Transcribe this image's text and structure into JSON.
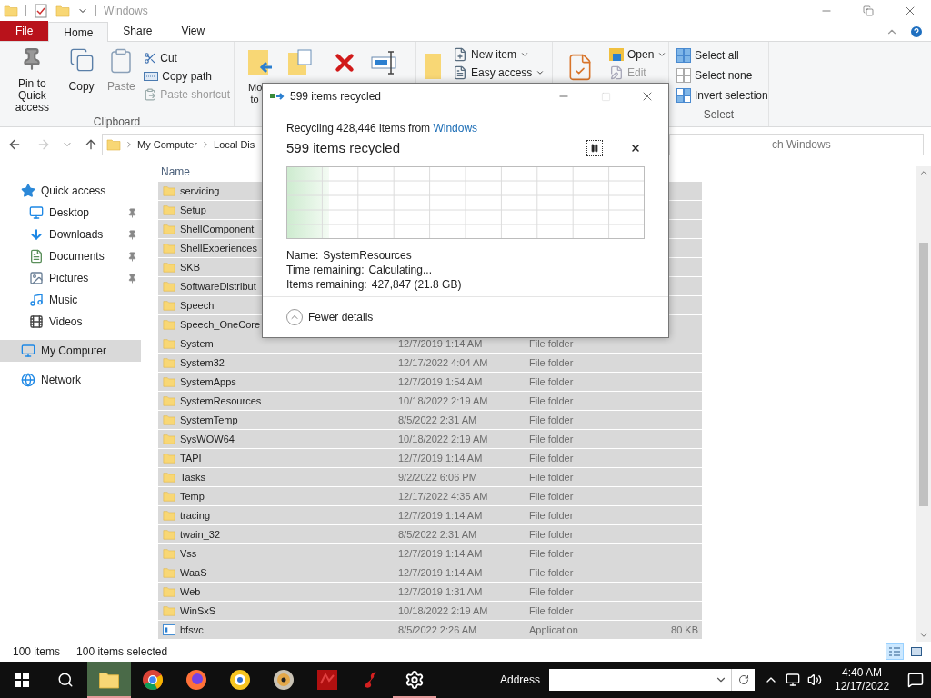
{
  "window": {
    "title": "Windows"
  },
  "ribbon_tabs": [
    {
      "label": "File",
      "kind": "file",
      "selected": false
    },
    {
      "label": "Home",
      "kind": "tab",
      "selected": true
    },
    {
      "label": "Share",
      "kind": "tab",
      "selected": false
    },
    {
      "label": "View",
      "kind": "tab",
      "selected": false
    }
  ],
  "ribbon": {
    "clipboard": {
      "label": "Clipboard",
      "pin": "Pin to Quick access",
      "copy": "Copy",
      "paste": {
        "label": "Paste",
        "disabled": true
      },
      "cut": {
        "label": "Cut",
        "disabled": false
      },
      "copy_path": {
        "label": "Copy path",
        "disabled": false
      },
      "paste_shortcut": {
        "label": "Paste shortcut",
        "disabled": true
      }
    },
    "organize": {
      "move_to": "Mo to"
    },
    "new": {
      "new_item": "New item",
      "easy_access": "Easy access"
    },
    "open": {
      "open": {
        "label": "Open",
        "disabled": false
      },
      "edit": {
        "label": "Edit",
        "disabled": true
      }
    },
    "select": {
      "label": "Select",
      "items": [
        "Select all",
        "Select none",
        "Invert selection"
      ]
    }
  },
  "address": {
    "path": [
      "My Computer",
      "Local Dis"
    ]
  },
  "search": {
    "placeholder": "ch Windows"
  },
  "sidebar": {
    "items": [
      {
        "label": "Quick access",
        "kind": "quick",
        "pinned": false,
        "selected": false
      },
      {
        "label": "Desktop",
        "kind": "desktop",
        "pinned": true,
        "selected": false
      },
      {
        "label": "Downloads",
        "kind": "downloads",
        "pinned": true,
        "selected": false
      },
      {
        "label": "Documents",
        "kind": "documents",
        "pinned": true,
        "selected": false
      },
      {
        "label": "Pictures",
        "kind": "pictures",
        "pinned": true,
        "selected": false
      },
      {
        "label": "Music",
        "kind": "music",
        "pinned": false,
        "selected": false
      },
      {
        "label": "Videos",
        "kind": "videos",
        "pinned": false,
        "selected": false
      },
      {
        "label": "My Computer",
        "kind": "computer",
        "pinned": false,
        "selected": true
      },
      {
        "label": "Network",
        "kind": "network",
        "pinned": false,
        "selected": false
      }
    ]
  },
  "columns": [
    {
      "label": "Name"
    }
  ],
  "rows": [
    {
      "name": "servicing",
      "kind": "folder",
      "selected": true
    },
    {
      "name": "Setup",
      "kind": "folder",
      "selected": true
    },
    {
      "name": "ShellComponent",
      "kind": "folder",
      "selected": true
    },
    {
      "name": "ShellExperiences",
      "kind": "folder",
      "selected": true
    },
    {
      "name": "SKB",
      "kind": "folder",
      "selected": true
    },
    {
      "name": "SoftwareDistribut",
      "kind": "folder",
      "selected": true
    },
    {
      "name": "Speech",
      "kind": "folder",
      "selected": true
    },
    {
      "name": "Speech_OneCore",
      "kind": "folder",
      "selected": true
    },
    {
      "name": "System",
      "date": "12/7/2019 1:14 AM",
      "type": "File folder",
      "kind": "folder",
      "selected": true
    },
    {
      "name": "System32",
      "date": "12/17/2022 4:04 AM",
      "type": "File folder",
      "kind": "folder",
      "selected": true
    },
    {
      "name": "SystemApps",
      "date": "12/7/2019 1:54 AM",
      "type": "File folder",
      "kind": "folder",
      "selected": true
    },
    {
      "name": "SystemResources",
      "date": "10/18/2022 2:19 AM",
      "type": "File folder",
      "kind": "folder",
      "selected": true
    },
    {
      "name": "SystemTemp",
      "date": "8/5/2022 2:31 AM",
      "type": "File folder",
      "kind": "folder",
      "selected": true
    },
    {
      "name": "SysWOW64",
      "date": "10/18/2022 2:19 AM",
      "type": "File folder",
      "kind": "folder",
      "selected": true
    },
    {
      "name": "TAPI",
      "date": "12/7/2019 1:14 AM",
      "type": "File folder",
      "kind": "folder",
      "selected": true
    },
    {
      "name": "Tasks",
      "date": "9/2/2022 6:06 PM",
      "type": "File folder",
      "kind": "folder",
      "selected": true
    },
    {
      "name": "Temp",
      "date": "12/17/2022 4:35 AM",
      "type": "File folder",
      "kind": "folder",
      "selected": true
    },
    {
      "name": "tracing",
      "date": "12/7/2019 1:14 AM",
      "type": "File folder",
      "kind": "folder",
      "selected": true
    },
    {
      "name": "twain_32",
      "date": "8/5/2022 2:31 AM",
      "type": "File folder",
      "kind": "folder",
      "selected": true
    },
    {
      "name": "Vss",
      "date": "12/7/2019 1:14 AM",
      "type": "File folder",
      "kind": "folder",
      "selected": true
    },
    {
      "name": "WaaS",
      "date": "12/7/2019 1:14 AM",
      "type": "File folder",
      "kind": "folder",
      "selected": true
    },
    {
      "name": "Web",
      "date": "12/7/2019 1:31 AM",
      "type": "File folder",
      "kind": "folder",
      "selected": true
    },
    {
      "name": "WinSxS",
      "date": "10/18/2022 2:19 AM",
      "type": "File folder",
      "kind": "folder",
      "selected": true
    },
    {
      "name": "bfsvc",
      "date": "8/5/2022 2:26 AM",
      "type": "Application",
      "size": "80 KB",
      "kind": "app",
      "selected": true
    }
  ],
  "status_bar": {
    "count": "100 items",
    "selection": "100 items selected"
  },
  "view_modes": [
    {
      "selected": true
    },
    {
      "selected": false
    }
  ],
  "dialog": {
    "title": "599 items recycled",
    "maximize_disabled": true,
    "source_prefix": "Recycling 428,446 items from",
    "source_link": "Windows",
    "status": "599 items recycled",
    "progress": {
      "level": 0.12
    },
    "details": [
      {
        "label": "Name:",
        "value": "SystemResources"
      },
      {
        "label": "Time remaining:",
        "value": "Calculating..."
      },
      {
        "label": "Items remaining:",
        "value": "427,847 (21.8 GB)"
      }
    ],
    "toggle": "Fewer details"
  },
  "taskbar": {
    "apps": [
      {
        "active": true,
        "running": true
      },
      {
        "active": false,
        "running": false
      },
      {
        "active": false,
        "running": false
      },
      {
        "active": false,
        "running": false
      },
      {
        "active": false,
        "running": false
      },
      {
        "active": false,
        "running": false
      },
      {
        "active": false,
        "running": false
      },
      {
        "active": false,
        "running": true
      }
    ],
    "address_label": "Address",
    "time": "4:40 AM",
    "date": "12/17/2022"
  }
}
